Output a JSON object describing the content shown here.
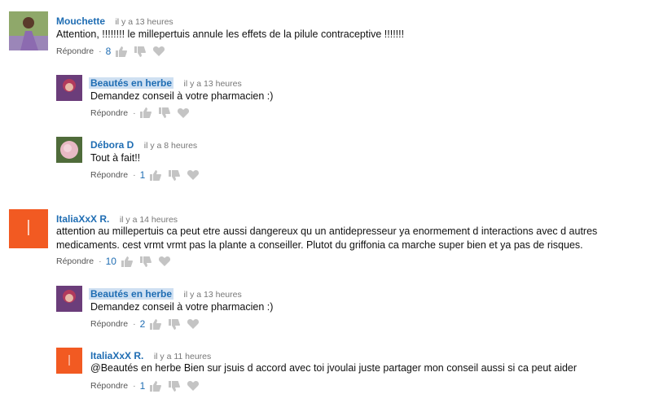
{
  "labels": {
    "reply": "Répondre"
  },
  "colors": {
    "author": "#1f6db3",
    "letter_avatar": "#f25a22",
    "highlight": "#cfe0f2"
  },
  "comments": [
    {
      "author": "Mouchette",
      "time": "il y a 13 heures",
      "text": "Attention, !!!!!!!! le millepertuis annule les effets de la pilule contraceptive !!!!!!!",
      "likes": "8",
      "avatar": "photo-woman-dress"
    },
    {
      "author": "Beautés en herbe",
      "time": "il y a 13 heures",
      "text": "Demandez conseil à votre pharmacien :)",
      "likes": "",
      "avatar": "photo-woman-red-hair"
    },
    {
      "author": "Débora D",
      "time": "il y a 8 heures",
      "text": "Tout à fait!!",
      "likes": "1",
      "avatar": "photo-pink-flower"
    },
    {
      "author": "ItaliaXxX R.",
      "time": "il y a 14 heures",
      "text_lines": [
        "attention au millepertuis ca peut etre aussi dangereux qu un antidepresseur ya enormement d interactions avec d autres",
        "medicaments. cest vrmt vrmt pas la plante a conseiller. Plutot du griffonia ca marche super bien et ya pas de risques."
      ],
      "likes": "10",
      "avatar_letter": "I"
    },
    {
      "author": "Beautés en herbe",
      "time": "il y a 13 heures",
      "text": "Demandez conseil à votre pharmacien :)",
      "likes": "2",
      "avatar": "photo-woman-red-hair"
    },
    {
      "author": "ItaliaXxX R.",
      "time": "il y a 11 heures",
      "text": "@Beautés en herbe Bien sur jsuis d accord avec toi jvoulai juste partager mon conseil aussi si ca peut aider",
      "likes": "1",
      "avatar_letter": "I"
    }
  ]
}
